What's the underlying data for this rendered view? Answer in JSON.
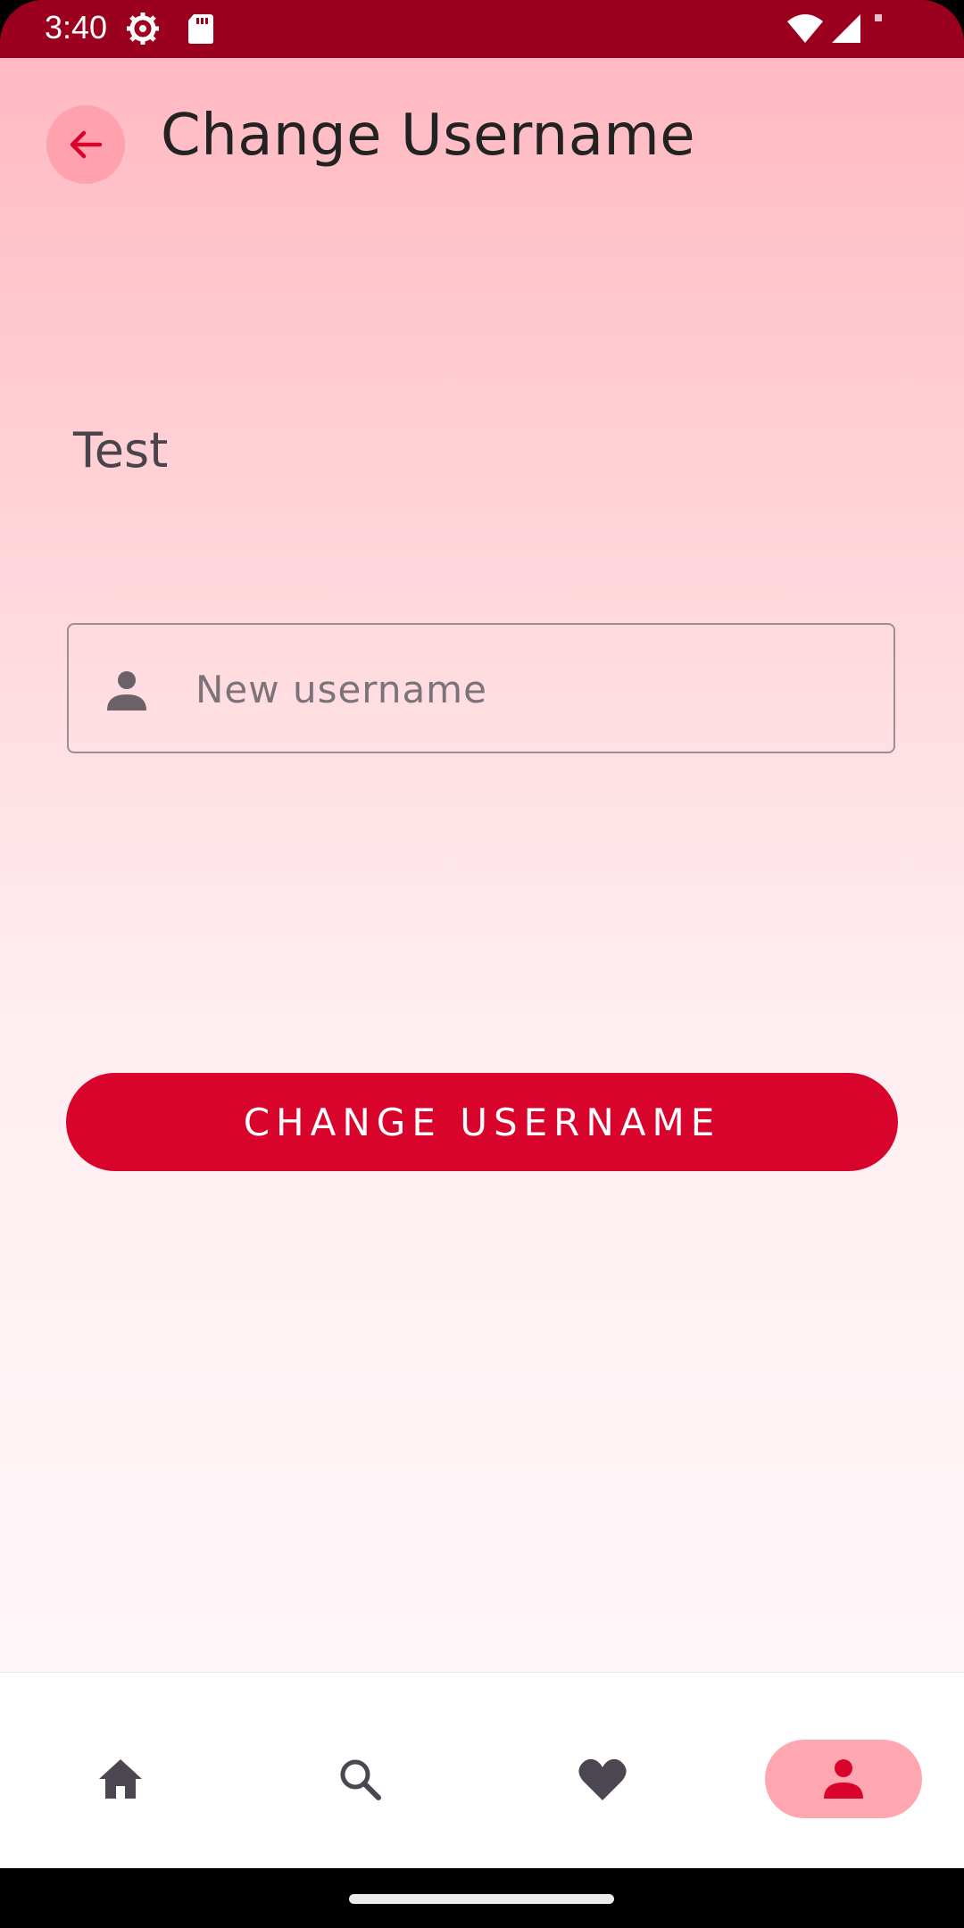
{
  "status_bar": {
    "time": "3:40",
    "icons": [
      "settings-gear-icon",
      "sd-card-icon",
      "wifi-icon",
      "signal-icon",
      "notification-dot-icon"
    ]
  },
  "header": {
    "back_icon": "arrow-back-icon",
    "title": "Change Username"
  },
  "main": {
    "current_username": "Test",
    "input": {
      "icon": "person-icon",
      "placeholder": "New username",
      "value": ""
    },
    "submit_label": "CHANGE USERNAME"
  },
  "bottom_nav": {
    "items": [
      {
        "icon": "home-icon",
        "active": false
      },
      {
        "icon": "search-icon",
        "active": false
      },
      {
        "icon": "heart-icon",
        "active": false
      },
      {
        "icon": "person-icon",
        "active": true
      }
    ]
  },
  "colors": {
    "status_bar": "#9c001f",
    "accent": "#d9042b",
    "back_button_bg": "#ffa2ad",
    "active_nav_bg": "#ffa7b0"
  }
}
